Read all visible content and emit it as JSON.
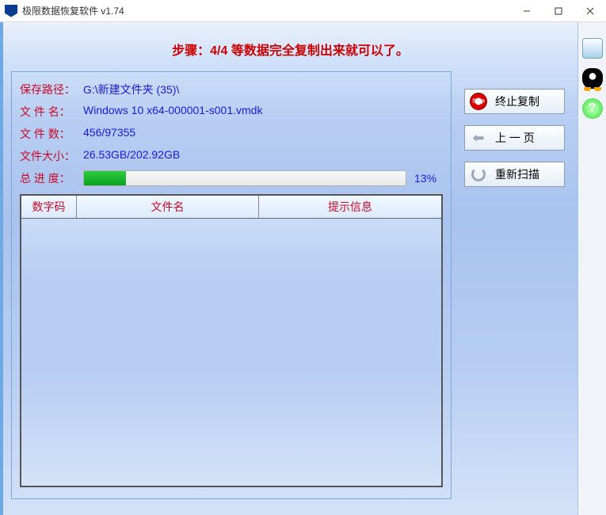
{
  "window": {
    "title": "极限数据恢复软件 v1.74"
  },
  "step_banner": "步骤：4/4 等数据完全复制出来就可以了。",
  "info": {
    "save_path_label": "保存路径：",
    "save_path_value": "G:\\新建文件夹 (35)\\",
    "file_name_label": "文 件 名：",
    "file_name_value": "Windows 10 x64-000001-s001.vmdk",
    "file_count_label": "文 件 数：",
    "file_count_value": "456/97355",
    "file_size_label": "文件大小：",
    "file_size_value": "26.53GB/202.92GB",
    "progress_label": "总 进 度：",
    "progress_pct": "13%",
    "progress_value": 13
  },
  "table": {
    "col1": "数字码",
    "col2": "文件名",
    "col3": "提示信息"
  },
  "buttons": {
    "stop": "终止复制",
    "back": "上 一 页",
    "rescan": "重新扫描"
  },
  "sidebar": {
    "help_glyph": "?"
  }
}
